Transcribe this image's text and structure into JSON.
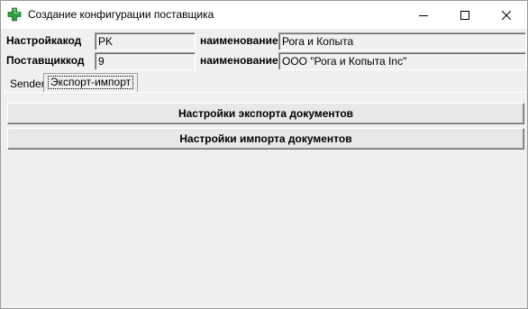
{
  "window": {
    "title": "Создание конфигурации поставщика",
    "icon": "green-cross-icon",
    "controls": [
      "minimize",
      "maximize",
      "close"
    ]
  },
  "form": {
    "row1": {
      "code_label": "Настройкакод",
      "code_value": "PK",
      "name_label": "наименование",
      "name_value": "Рога и Копыта"
    },
    "row2": {
      "code_label": "Поставщиккод",
      "code_value": "9",
      "name_label": "наименование",
      "name_value": "ООО \"Рога и Копыта Inc\""
    }
  },
  "tabs": [
    {
      "label": "Sender",
      "active": false
    },
    {
      "label": "Экспорт-импорт",
      "active": true
    }
  ],
  "buttons": {
    "export_label": "Настройки экспорта документов",
    "import_label": "Настройки импорта документов"
  },
  "colors": {
    "icon_green": "#2e9e3e",
    "window_bg": "#f0f0f0"
  }
}
